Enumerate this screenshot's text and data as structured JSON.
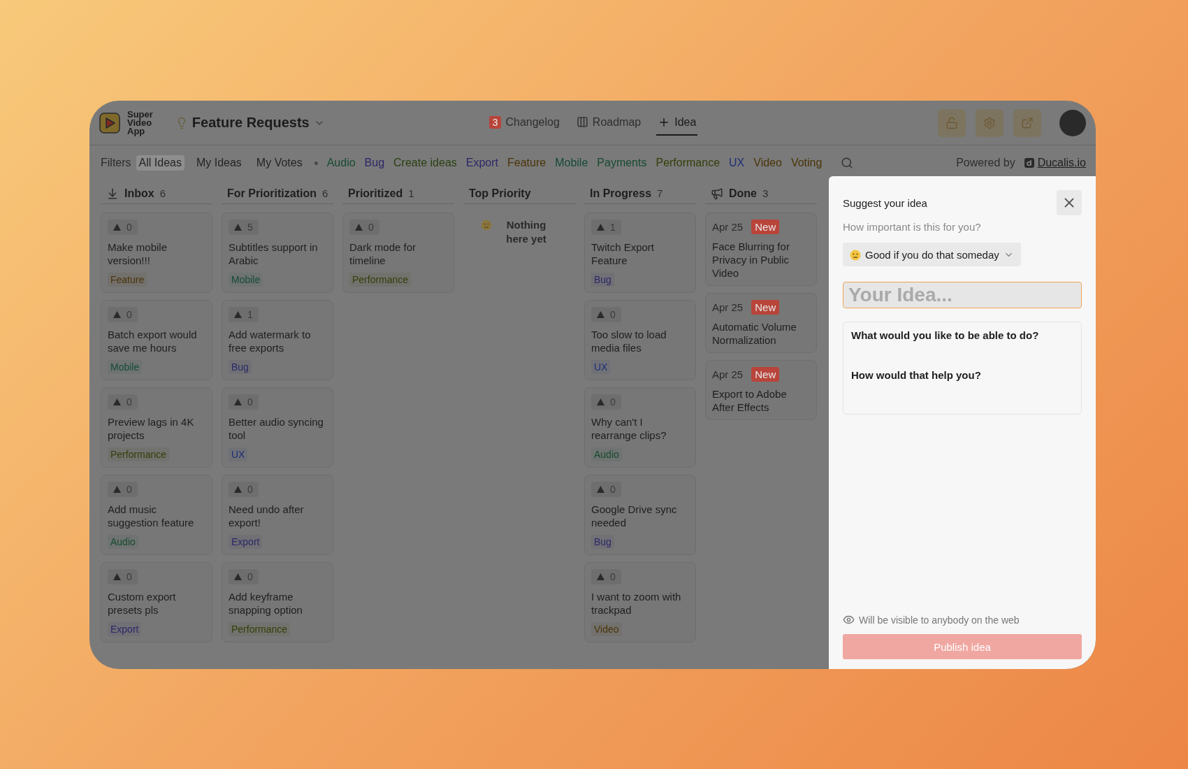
{
  "header": {
    "logo_lines": [
      "Super",
      "Video",
      "App"
    ],
    "board_title": "Feature Requests",
    "nav": [
      {
        "kind": "changelog",
        "label": "Changelog",
        "badge": "3",
        "selected": false
      },
      {
        "kind": "roadmap",
        "label": "Roadmap",
        "selected": false
      },
      {
        "kind": "add",
        "label": "Idea",
        "selected": true
      }
    ],
    "actions": [
      {
        "kind": "lock"
      },
      {
        "kind": "settings"
      },
      {
        "kind": "share"
      }
    ]
  },
  "filters": {
    "label": "Filters",
    "views": [
      {
        "label": "All Ideas",
        "selected": true
      },
      {
        "label": "My Ideas",
        "selected": false
      },
      {
        "label": "My Votes",
        "selected": false
      }
    ],
    "tags": [
      {
        "label": "Audio",
        "color": "#174a30"
      },
      {
        "label": "Bug",
        "color": "#2c2868"
      },
      {
        "label": "Create ideas",
        "color": "#2a4012"
      },
      {
        "label": "Export",
        "color": "#2c2868"
      },
      {
        "label": "Feature",
        "color": "#4a3408"
      },
      {
        "label": "Mobile",
        "color": "#154a3a"
      },
      {
        "label": "Payments",
        "color": "#174a30"
      },
      {
        "label": "Performance",
        "color": "#333f08"
      },
      {
        "label": "UX",
        "color": "#1f2e78"
      },
      {
        "label": "Video",
        "color": "#4a3408"
      },
      {
        "label": "Voting",
        "color": "#4a3408"
      }
    ],
    "powered_by": "Powered by",
    "powered_link": "Ducalis.io"
  },
  "columns": [
    {
      "title": "Inbox",
      "count": "6",
      "kind": "inbox",
      "cards": [
        {
          "votes": "0",
          "title": "Make mobile version!!!",
          "tag": {
            "label": "Feature",
            "color": "#4a3408"
          }
        },
        {
          "votes": "0",
          "title": "Batch export would save me hours",
          "tag": {
            "label": "Mobile",
            "color": "#154a3a"
          }
        },
        {
          "votes": "0",
          "title": "Preview lags in 4K projects",
          "tag": {
            "label": "Performance",
            "color": "#333f08"
          }
        },
        {
          "votes": "0",
          "title": "Add music suggestion feature",
          "tag": {
            "label": "Audio",
            "color": "#174a30"
          }
        },
        {
          "votes": "0",
          "title": "Custom export presets pls",
          "tag": {
            "label": "Export",
            "color": "#2c2868"
          }
        }
      ]
    },
    {
      "title": "For Prioritization",
      "count": "6",
      "kind": "plain",
      "cards": [
        {
          "votes": "5",
          "title": "Subtitles support in Arabic",
          "tag": {
            "label": "Mobile",
            "color": "#154a3a"
          }
        },
        {
          "votes": "1",
          "title": "Add watermark to free exports",
          "tag": {
            "label": "Bug",
            "color": "#2c2868"
          }
        },
        {
          "votes": "0",
          "title": "Better audio syncing tool",
          "tag": {
            "label": "UX",
            "color": "#1f2e78"
          }
        },
        {
          "votes": "0",
          "title": "Need undo after export!",
          "tag": {
            "label": "Export",
            "color": "#2c2868"
          }
        },
        {
          "votes": "0",
          "title": "Add keyframe snapping option",
          "tag": {
            "label": "Performance",
            "color": "#333f08"
          }
        }
      ]
    },
    {
      "title": "Prioritized",
      "count": "1",
      "kind": "plain",
      "cards": [
        {
          "votes": "0",
          "title": "Dark mode for timeline",
          "tag": {
            "label": "Performance",
            "color": "#333f08"
          }
        }
      ]
    },
    {
      "title": "Top Priority",
      "kind": "plain",
      "empty_text": "Nothing here yet"
    },
    {
      "title": "In Progress",
      "count": "7",
      "kind": "plain",
      "cards": [
        {
          "votes": "1",
          "title": "Twitch Export Feature",
          "tag": {
            "label": "Bug",
            "color": "#2c2868"
          }
        },
        {
          "votes": "0",
          "title": "Too slow to load media files",
          "tag": {
            "label": "UX",
            "color": "#1f2e78"
          }
        },
        {
          "votes": "0",
          "title": "Why can't I rearrange clips?",
          "tag": {
            "label": "Audio",
            "color": "#174a30"
          }
        },
        {
          "votes": "0",
          "title": "Google Drive sync needed",
          "tag": {
            "label": "Bug",
            "color": "#2c2868"
          }
        },
        {
          "votes": "0",
          "title": "I want to zoom with trackpad",
          "tag": {
            "label": "Video",
            "color": "#4a3408"
          }
        }
      ]
    },
    {
      "title": "Done",
      "count": "3",
      "kind": "done",
      "cards": [
        {
          "date": "Apr 25",
          "badge": "New",
          "title": "Face Blurring for Privacy in Public Video"
        },
        {
          "date": "Apr 25",
          "badge": "New",
          "title": "Automatic Volume Normalization"
        },
        {
          "date": "Apr 25",
          "badge": "New",
          "title": "Export to Adobe After Effects"
        }
      ]
    }
  ],
  "panel": {
    "title": "Suggest your idea",
    "question": "How important is this for you?",
    "importance": "Good if you do that someday",
    "idea_placeholder": "Your Idea...",
    "prompts": [
      "What would you like to be able to do?",
      "How would that help you?"
    ],
    "visibility_note": "Will be visible to anybody on the web",
    "publish": "Publish idea"
  }
}
